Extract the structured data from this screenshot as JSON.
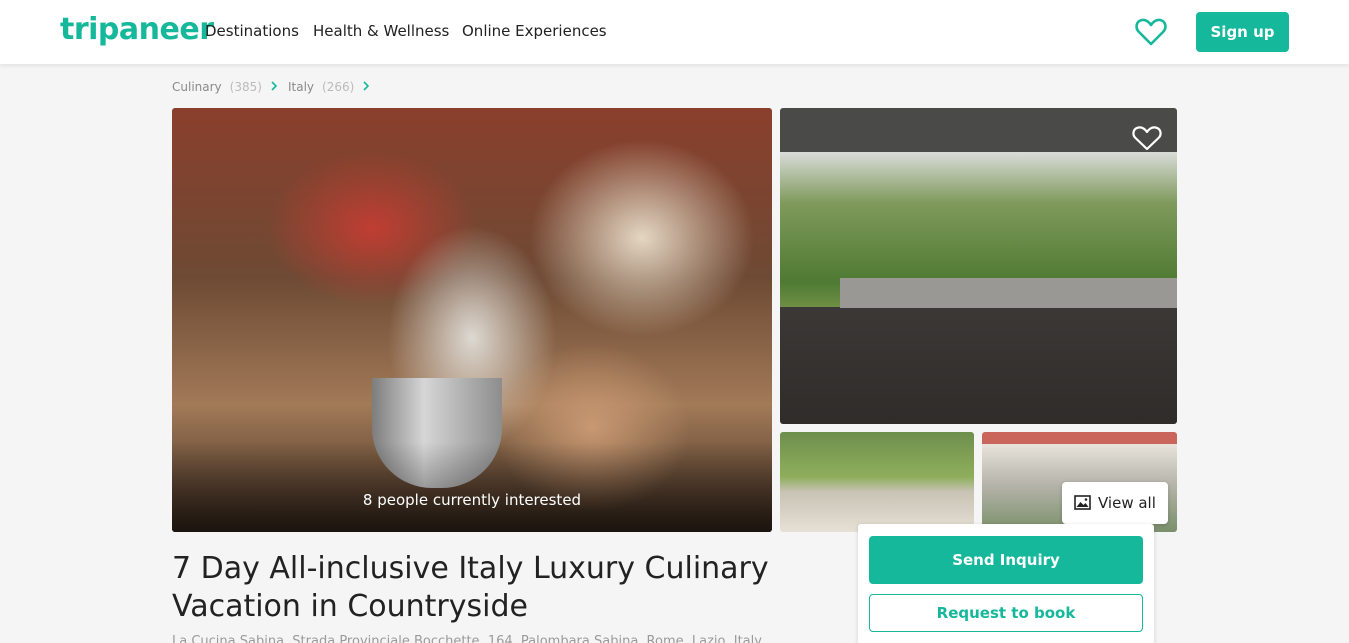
{
  "header": {
    "logo": "tripaneer",
    "nav": [
      "Destinations",
      "Health & Wellness",
      "Online Experiences"
    ],
    "signup_label": "Sign up"
  },
  "breadcrumb": [
    {
      "label": "Culinary",
      "count": "(385)"
    },
    {
      "label": "Italy",
      "count": "(266)"
    }
  ],
  "gallery": {
    "interest_text": "8 people currently interested",
    "view_all_label": "View all"
  },
  "listing": {
    "title": "7 Day All-inclusive Italy Luxury Culinary Vacation in Countryside",
    "address": "La Cucina Sabina, Strada Provinciale Bocchette, 164, Palombara Sabina, Rome, Lazio, Italy"
  },
  "booking": {
    "send_inquiry_label": "Send Inquiry",
    "request_label": "Request to book"
  },
  "colors": {
    "brand": "#15b89a",
    "background": "#f5f5f5"
  },
  "icons": [
    "heart-icon",
    "chevron-right-icon",
    "image-icon"
  ]
}
